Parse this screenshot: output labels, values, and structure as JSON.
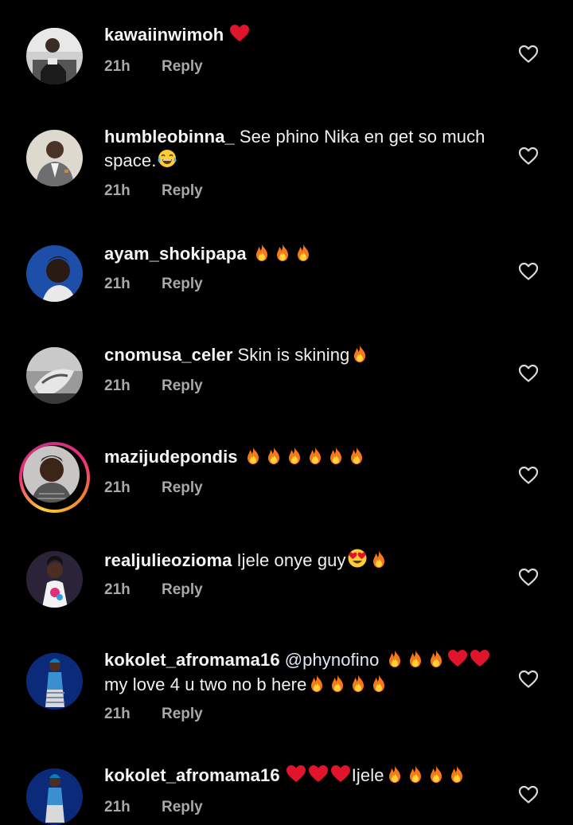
{
  "comments": [
    {
      "username": "kawaiinwimoh",
      "segments": [
        {
          "type": "emoji",
          "name": "heart"
        }
      ],
      "time": "21h",
      "reply_label": "Reply"
    },
    {
      "username": "humbleobinna_",
      "segments": [
        {
          "type": "text",
          "value": "See phino Nika en get so much space."
        },
        {
          "type": "emoji",
          "name": "joy"
        }
      ],
      "time": "21h",
      "reply_label": "Reply"
    },
    {
      "username": "ayam_shokipapa",
      "segments": [
        {
          "type": "emoji",
          "name": "fire"
        },
        {
          "type": "emoji",
          "name": "fire"
        },
        {
          "type": "emoji",
          "name": "fire"
        }
      ],
      "time": "21h",
      "reply_label": "Reply"
    },
    {
      "username": "cnomusa_celer",
      "segments": [
        {
          "type": "text",
          "value": "Skin is skining"
        },
        {
          "type": "emoji",
          "name": "fire"
        }
      ],
      "time": "21h",
      "reply_label": "Reply"
    },
    {
      "username": "mazijudepondis",
      "segments": [
        {
          "type": "emoji",
          "name": "fire"
        },
        {
          "type": "emoji",
          "name": "fire"
        },
        {
          "type": "emoji",
          "name": "fire"
        },
        {
          "type": "emoji",
          "name": "fire"
        },
        {
          "type": "emoji",
          "name": "fire"
        },
        {
          "type": "emoji",
          "name": "fire"
        }
      ],
      "time": "21h",
      "reply_label": "Reply",
      "story_ring": true
    },
    {
      "username": "realjulieozioma",
      "segments": [
        {
          "type": "text",
          "value": "Ijele onye guy"
        },
        {
          "type": "emoji",
          "name": "heart-eyes"
        },
        {
          "type": "emoji",
          "name": "fire"
        }
      ],
      "time": "21h",
      "reply_label": "Reply"
    },
    {
      "username": "kokolet_afromama16",
      "segments": [
        {
          "type": "mention",
          "value": "@phynofino"
        },
        {
          "type": "emoji",
          "name": "fire"
        },
        {
          "type": "emoji",
          "name": "fire"
        },
        {
          "type": "emoji",
          "name": "fire"
        },
        {
          "type": "emoji",
          "name": "heart"
        },
        {
          "type": "emoji",
          "name": "heart"
        },
        {
          "type": "text",
          "value": "my love 4 u two no b here"
        },
        {
          "type": "emoji",
          "name": "fire"
        },
        {
          "type": "emoji",
          "name": "fire"
        },
        {
          "type": "emoji",
          "name": "fire"
        },
        {
          "type": "emoji",
          "name": "fire"
        }
      ],
      "time": "21h",
      "reply_label": "Reply"
    },
    {
      "username": "kokolet_afromama16",
      "segments": [
        {
          "type": "emoji",
          "name": "heart"
        },
        {
          "type": "emoji",
          "name": "heart"
        },
        {
          "type": "emoji",
          "name": "heart"
        },
        {
          "type": "text",
          "value": "Ijele"
        },
        {
          "type": "emoji",
          "name": "fire"
        },
        {
          "type": "emoji",
          "name": "fire"
        },
        {
          "type": "emoji",
          "name": "fire"
        },
        {
          "type": "emoji",
          "name": "fire"
        }
      ],
      "time": "21h",
      "reply_label": "Reply"
    }
  ],
  "icons": {
    "like": "heart-outline-icon"
  },
  "colors": {
    "background": "#000000",
    "text": "#f5f5f5",
    "meta": "#a8a8a8",
    "heart_emoji": "#e0142b"
  }
}
